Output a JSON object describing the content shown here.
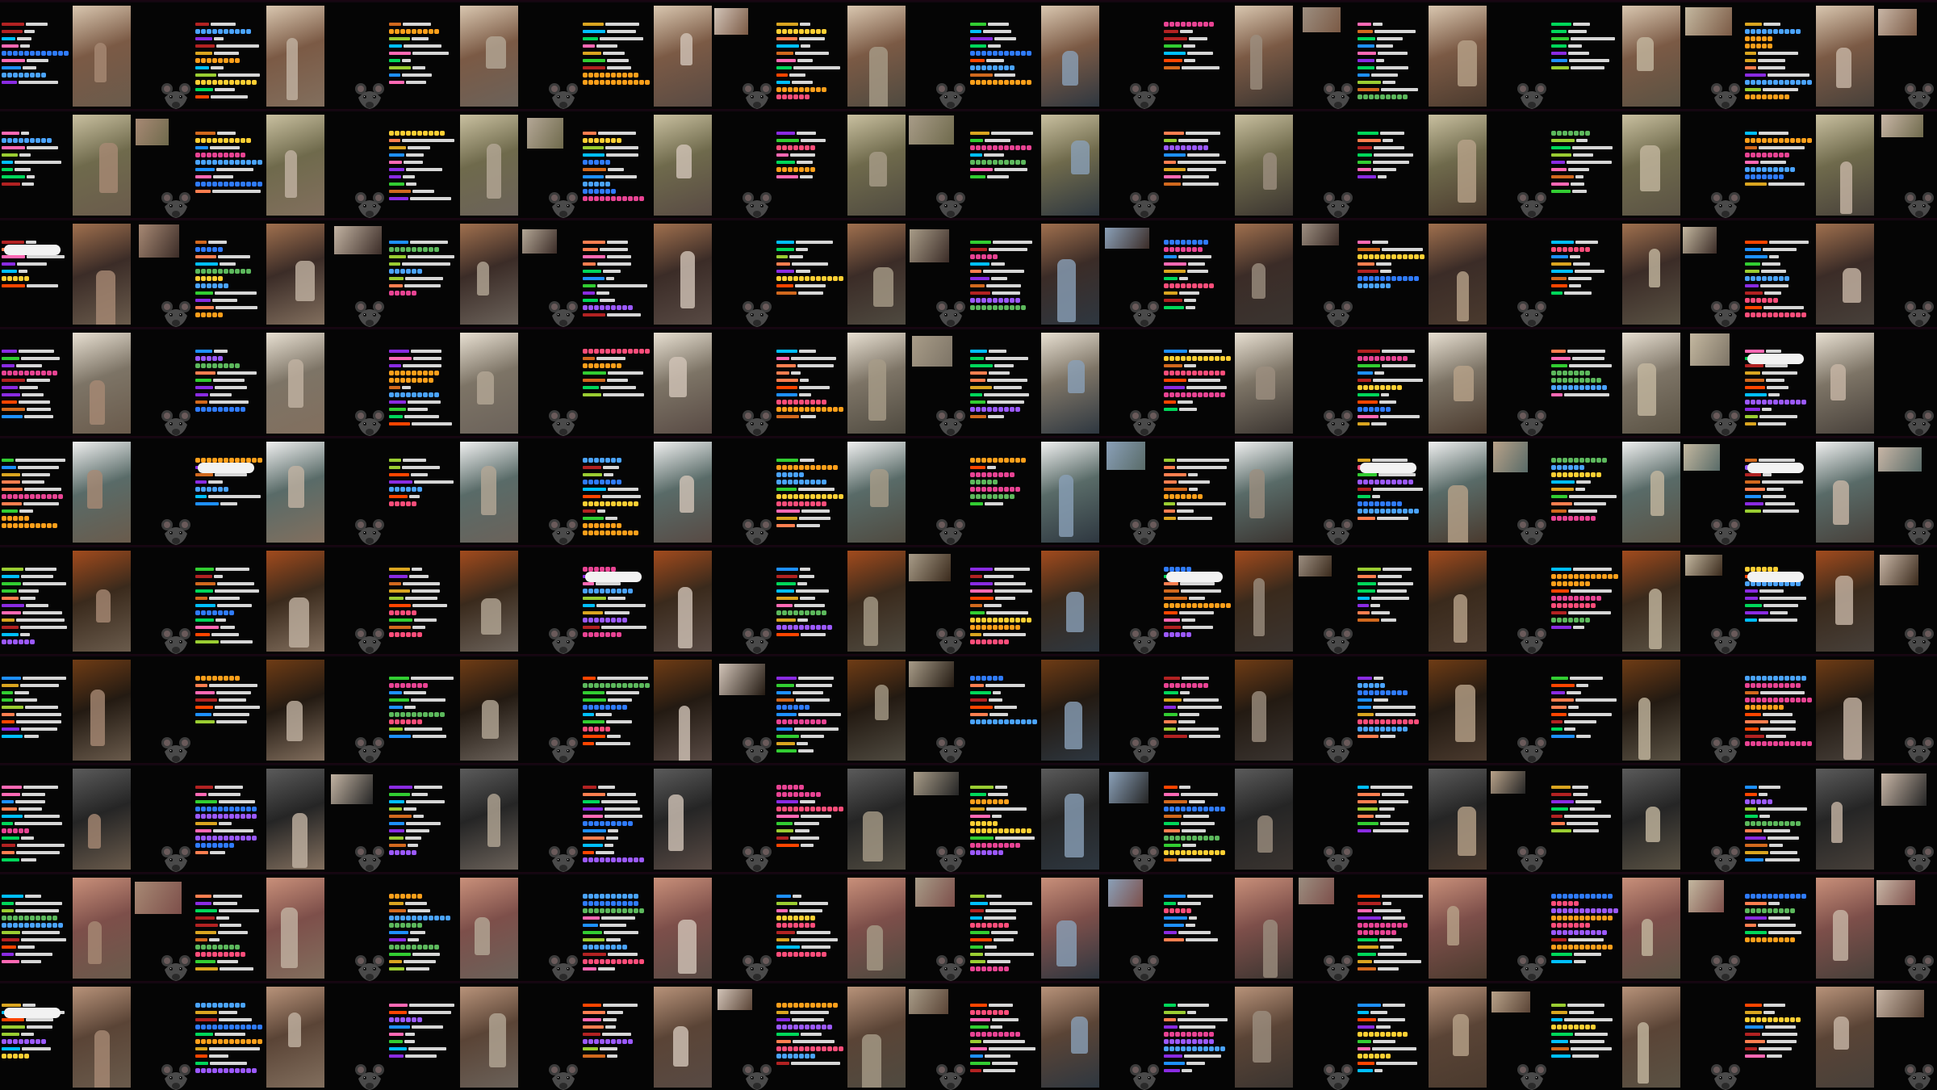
{
  "grid": {
    "columns": 10,
    "rows": 10
  },
  "chat_colors": [
    "#00d75a",
    "#8a2be2",
    "#ff69b4",
    "#1e90ff",
    "#ff4500",
    "#daa520",
    "#32cd32",
    "#b22222",
    "#00bfff",
    "#ff7f50",
    "#9acd32",
    "#d2691e"
  ],
  "emote_colors": [
    "#2f7bff",
    "#4aa3ff",
    "#ff4d7a",
    "#ff9f1a",
    "#9b59ff",
    "#ffcf33",
    "#e84393",
    "#5cb85c"
  ],
  "overlays": {
    "0": {
      "tint": "#7b5a45",
      "accent": "#d9c7b0"
    },
    "1": {
      "tint": "#6f6a4c",
      "accent": "#c9c0a0"
    },
    "2": {
      "tint": "#3b2c27",
      "accent": "#a0704e"
    },
    "3": {
      "tint": "#7d7466",
      "accent": "#e8e0d2"
    },
    "4": {
      "tint": "#596b68",
      "accent": "#f0f0f0"
    },
    "5": {
      "tint": "#3a2a1c",
      "accent": "#a24b1d"
    },
    "6": {
      "tint": "#231a12",
      "accent": "#6f3c15"
    },
    "7": {
      "tint": "#252525",
      "accent": "#5b5b5b"
    },
    "8": {
      "tint": "#7d4f4a",
      "accent": "#c9907a"
    },
    "9": {
      "tint": "#5a4436",
      "accent": "#b8937a"
    }
  },
  "column_media": [
    {
      "left": "#6a5b4c",
      "right": "#a78974"
    },
    {
      "left": "#826f5e",
      "right": "#c2b3a2"
    },
    {
      "left": "#6b625a",
      "right": "#b4a796"
    },
    {
      "left": "#584a44",
      "right": "#d2c4b8"
    },
    {
      "left": "#4f4a40",
      "right": "#a89c88"
    },
    {
      "left": "#2e3740",
      "right": "#8aa0b8"
    },
    {
      "left": "#3a3430",
      "right": "#9c8e80"
    },
    {
      "left": "#4a3a2e",
      "right": "#b8a289"
    },
    {
      "left": "#5a5244",
      "right": "#c4b8a0"
    },
    {
      "left": "#47403a",
      "right": "#c8b6a6"
    }
  ],
  "popup_cells": [
    20,
    39,
    41,
    47,
    49,
    53,
    56,
    59,
    90
  ],
  "masks": "rat-mask-icon"
}
